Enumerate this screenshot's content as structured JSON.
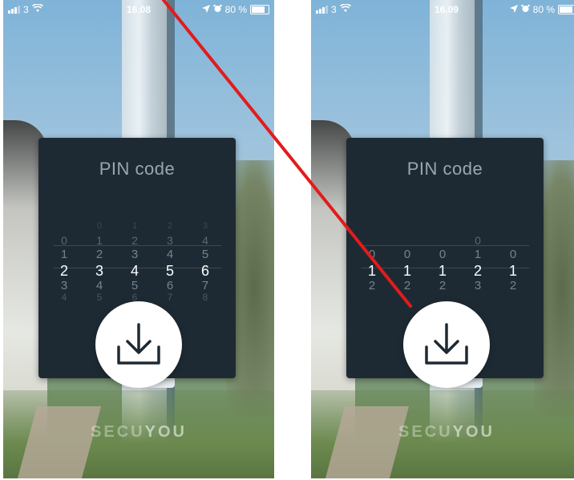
{
  "screens": [
    {
      "status": {
        "signal": "3",
        "time": "16.08",
        "battery": "80 %",
        "battery_level": 0.8
      },
      "title": "PIN code",
      "wheel": {
        "columns": [
          [
            "",
            "0",
            "1",
            "2",
            "3",
            "4"
          ],
          [
            "0",
            "1",
            "2",
            "3",
            "4",
            "5"
          ],
          [
            "1",
            "2",
            "3",
            "4",
            "5",
            "6"
          ],
          [
            "2",
            "3",
            "4",
            "5",
            "6",
            "7"
          ],
          [
            "3",
            "4",
            "5",
            "6",
            "7",
            "8"
          ]
        ],
        "selected": [
          "1",
          "2",
          "3",
          "4",
          "5"
        ]
      },
      "brand": {
        "part1": "SECU",
        "part2": "YOU"
      }
    },
    {
      "status": {
        "signal": "3",
        "time": "16.09",
        "battery": "80 %",
        "battery_level": 0.8
      },
      "title": "PIN code",
      "wheel": {
        "columns": [
          [
            "",
            "",
            "0",
            "1",
            "2",
            ""
          ],
          [
            "",
            "",
            "0",
            "1",
            "2",
            ""
          ],
          [
            "",
            "",
            "0",
            "1",
            "2",
            ""
          ],
          [
            "",
            "0",
            "1",
            "2",
            "3",
            ""
          ],
          [
            "",
            "",
            "0",
            "1",
            "2",
            ""
          ]
        ],
        "selected": [
          "0",
          "0",
          "0",
          "1",
          "0"
        ]
      },
      "brand": {
        "part1": "SECU",
        "part2": "YOU"
      }
    }
  ],
  "icons": {
    "wifi": "wifi-icon",
    "location": "location-arrow-icon",
    "alarm": "alarm-icon",
    "download": "download-icon"
  }
}
